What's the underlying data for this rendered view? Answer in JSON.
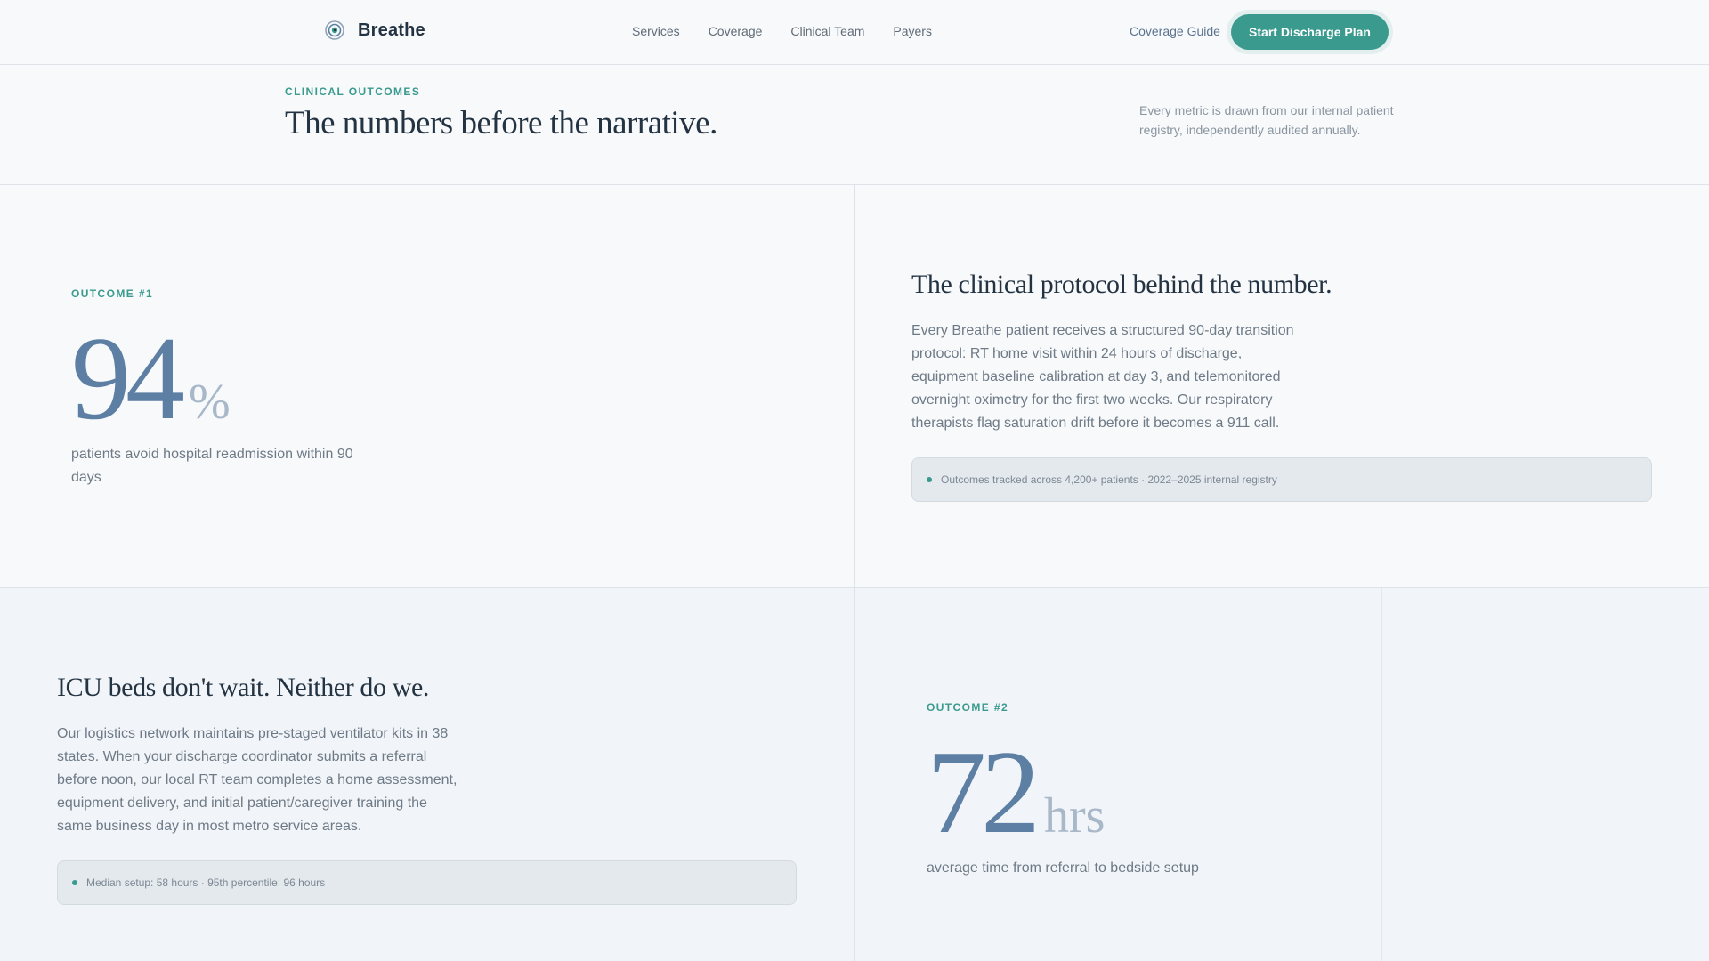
{
  "nav": {
    "brand": "Breathe",
    "links": [
      "Services",
      "Coverage",
      "Clinical Team",
      "Payers"
    ],
    "guide": "Coverage Guide",
    "cta": "Start Discharge Plan"
  },
  "intro": {
    "eyebrow": "CLINICAL OUTCOMES",
    "title": "The numbers before the narrative.",
    "note": "Every metric is drawn from our internal patient registry, independently audited annually."
  },
  "outcome1": {
    "eyebrow": "OUTCOME #1",
    "value": "94",
    "unit": "%",
    "description": "patients avoid hospital readmission within 90 days"
  },
  "protocol": {
    "title": "The clinical protocol behind the number.",
    "body": "Every Breathe patient receives a structured 90-day transition protocol: RT home visit within 24 hours of discharge, equipment baseline calibration at day 3, and telemonitored overnight oximetry for the first two weeks. Our respiratory therapists flag saturation drift before it becomes a 911 call.",
    "callout": "Outcomes tracked across 4,200+ patients · 2022–2025 internal registry"
  },
  "icu": {
    "title": "ICU beds don't wait. Neither do we.",
    "body": "Our logistics network maintains pre-staged ventilator kits in 38 states. When your discharge coordinator submits a referral before noon, our local RT team completes a home assessment, equipment delivery, and initial patient/caregiver training the same business day in most metro service areas.",
    "callout": "Median setup: 58 hours · 95th percentile: 96 hours"
  },
  "outcome2": {
    "eyebrow": "OUTCOME #2",
    "value": "72",
    "unit": "hrs",
    "description": "average time from referral to bedside setup"
  },
  "colors": {
    "accent": "#3a9a8e",
    "metric": "#5c7fa3",
    "metric_unit": "#a8b8c9",
    "heading": "#243342"
  },
  "icons": {
    "brand": "breathe-logo-icon",
    "callout": "bullet-dot-icon"
  }
}
